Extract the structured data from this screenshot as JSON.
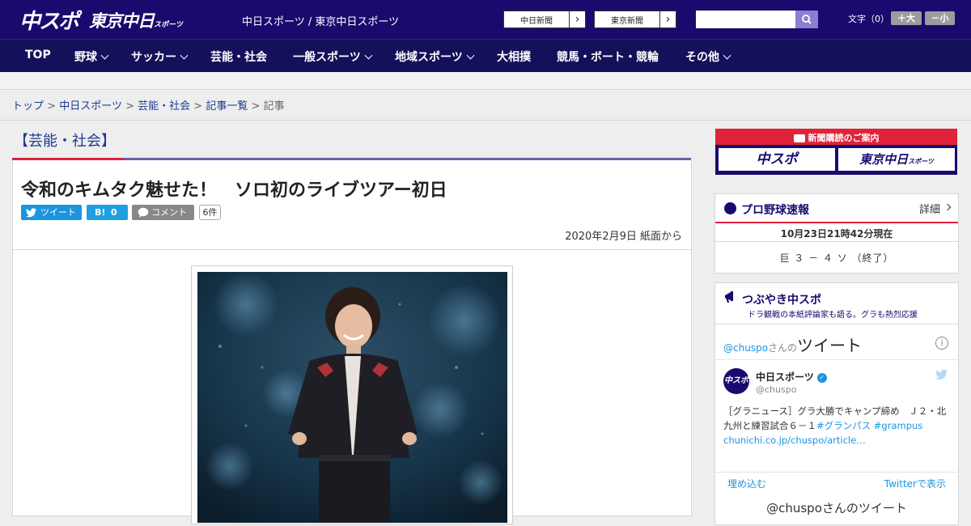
{
  "header": {
    "logo_primary": "中スポ",
    "logo_secondary": "東京中日",
    "logo_secondary_small": "スポーツ",
    "site_title": "中日スポーツ / 東京中日スポーツ",
    "paper_links": [
      {
        "label": "中日新聞"
      },
      {
        "label": "東京新聞"
      }
    ],
    "search": {
      "value": "",
      "placeholder": ""
    },
    "font_size_label": "文字（0）",
    "font_size_up": "＋大",
    "font_size_down": "－小"
  },
  "nav": {
    "items": [
      {
        "label": "TOP"
      },
      {
        "label": "野球"
      },
      {
        "label": "サッカー"
      },
      {
        "label": "芸能・社会"
      },
      {
        "label": "一般スポーツ"
      },
      {
        "label": "地域スポーツ"
      },
      {
        "label": "大相撲"
      },
      {
        "label": "競馬・ボート・競輪"
      },
      {
        "label": "その他"
      }
    ]
  },
  "breadcrumb": {
    "items": [
      "トップ",
      "中日スポーツ",
      "芸能・社会",
      "記事一覧"
    ],
    "separator": ">",
    "current": "記事"
  },
  "article": {
    "category": "【芸能・社会】",
    "headline": "令和のキムタク魅せた！　ソロ初のライブツアー初日",
    "share": {
      "tweet": "ツイート",
      "hatena_label": "B!",
      "hatena_count": "0",
      "comment": "コメント",
      "comment_count": "6件"
    },
    "dateline": "2020年2月9日 紙面から"
  },
  "sidebar": {
    "subscribe": {
      "title": "新聞購読のご案内",
      "left": "中スポ",
      "right": "東京中日",
      "right_small": "スポーツ"
    },
    "baseball": {
      "title": "プロ野球速報",
      "detail": "詳細",
      "timestamp": "10月23日21時42分現在",
      "score": "巨 ３ － ４ ソ （終了）"
    },
    "twitter": {
      "title": "つぶやき中スポ",
      "subtitle": "ドラ観戦の本紙評論家も語る。グラも熱烈応援",
      "handle_prefix": "@chuspo",
      "handle_suffix": "さんの",
      "tweets_word": "ツイート",
      "info": "i",
      "avatar_text": "中スポ",
      "account_name": "中日スポーツ",
      "account_handle": "@chuspo",
      "tweet_text": "［グラニュース］グラ大勝でキャンプ締め　Ｊ２・北九州と練習試合６－１",
      "tweet_tags": "#グランパス #grampus",
      "tweet_link": "chunichi.co.jp/chuspo/article…",
      "embed": "埋め込む",
      "view_on_twitter": "Twitterで表示",
      "bottom_title": "@chuspoさんのツイート"
    }
  },
  "colors": {
    "brand_navy": "#190a6e",
    "nav_bg": "#15105a",
    "accent_red": "#e0223a",
    "link_blue": "#1a3b8e",
    "twitter_blue": "#1b95e0"
  }
}
